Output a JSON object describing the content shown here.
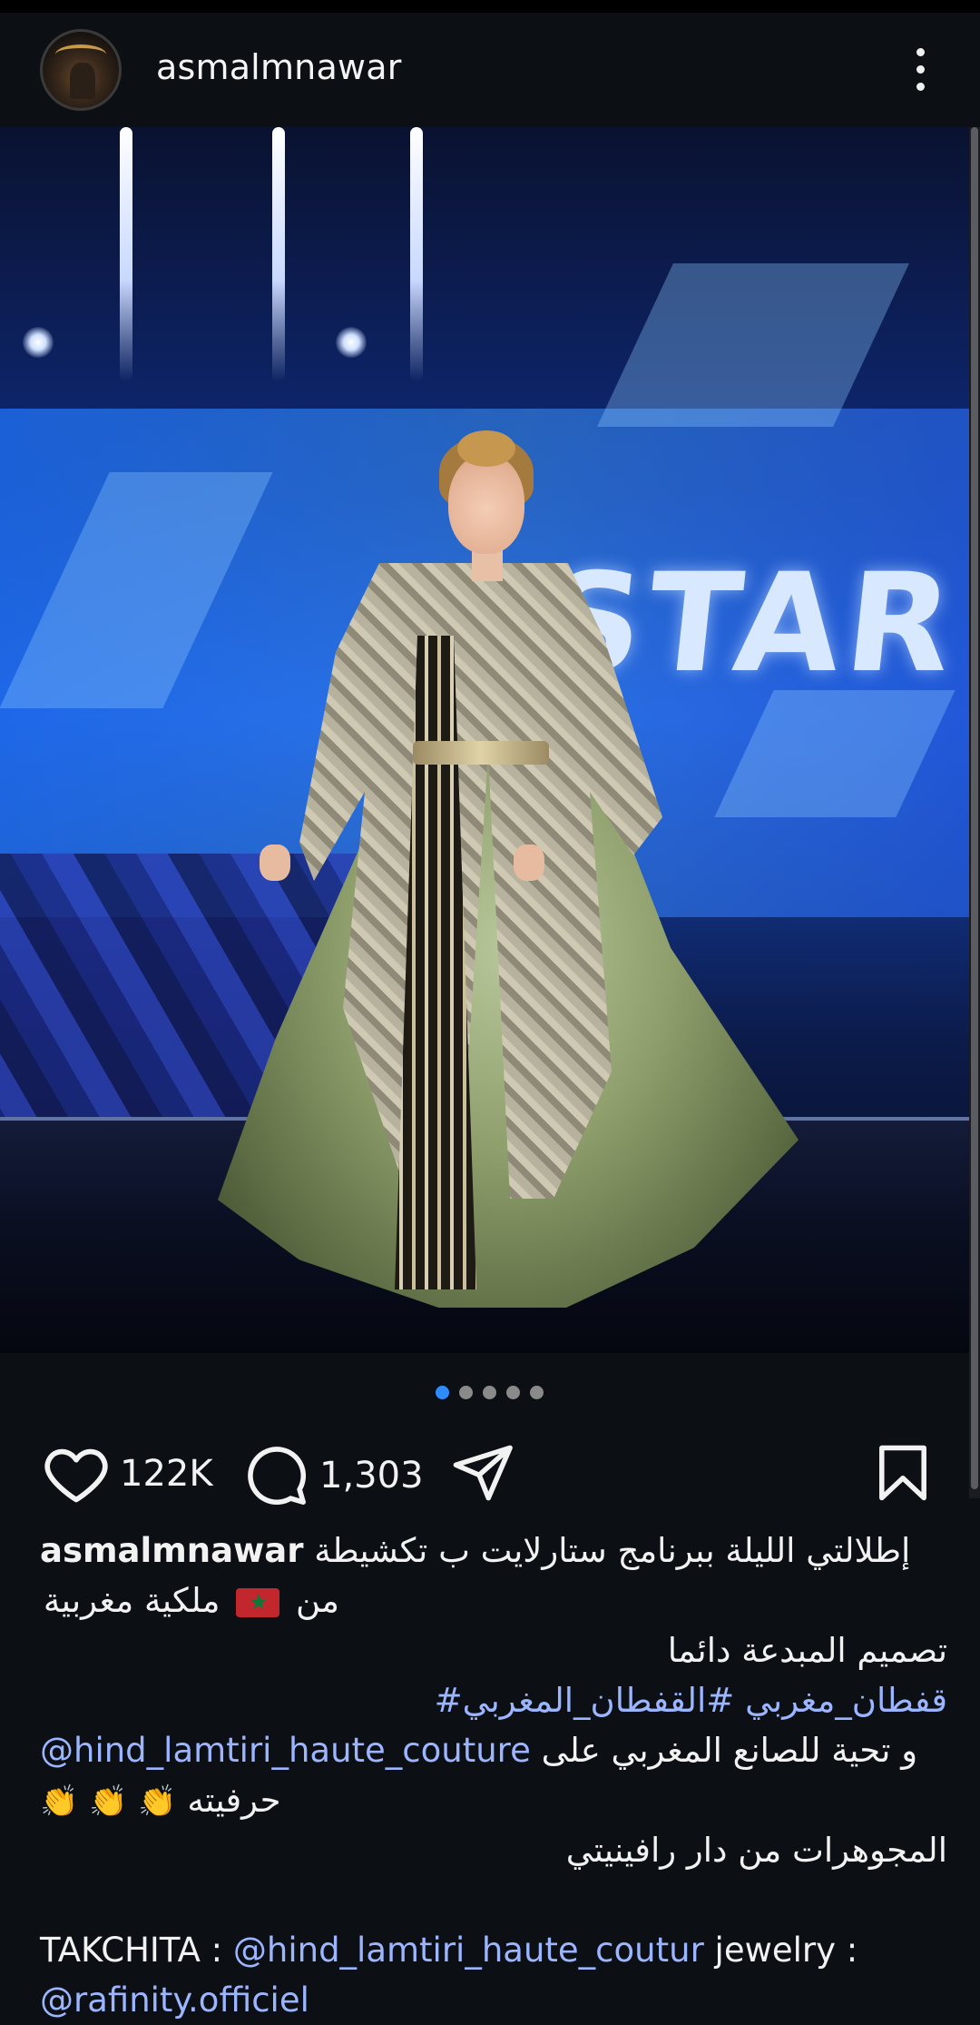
{
  "header": {
    "username": "asmalmnawar"
  },
  "carousel": {
    "count": 5,
    "active_index": 0,
    "photo_sign_text": "STAR"
  },
  "actions": {
    "likes": "122K",
    "comments": "1,303"
  },
  "caption": {
    "username": "asmalmnawar",
    "line1": "إطلالتي الليلة ببرنامج ستارلايت ب تكشيطة",
    "line2_prefix": "من",
    "line2_suffix": "ملكية مغربية",
    "line3": "تصميم المبدعة دائما",
    "hashtag1": "#القفطان_المغربي",
    "hashtag2": "#قفطان_مغربي",
    "mention1": "@hind_lamtiri_haute_couture",
    "line5_text": "و تحية للصانع المغربي على",
    "line6_text": "حرفيته",
    "clap": "👏",
    "line7": "المجوهرات من دار رافينيتي",
    "takchita_label": "TAKCHITA :",
    "mention2": "@hind_lamtiri_haute_coutur",
    "jewelry_label": "jewelry :",
    "mention3": "@rafinity.officiel"
  },
  "colors": {
    "background": "#0c0f14",
    "link": "#9bb5ff",
    "active_dot": "#2f8cff"
  }
}
